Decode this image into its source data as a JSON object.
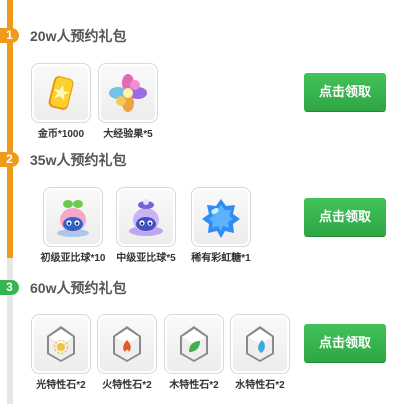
{
  "tiers": [
    {
      "number": "1",
      "title": "20w人预约礼包",
      "items": [
        {
          "label": "金币*1000",
          "icon": "gold-coin-icon"
        },
        {
          "label": "大经验果*5",
          "icon": "exp-fruit-icon"
        }
      ],
      "button": "点击领取"
    },
    {
      "number": "2",
      "title": "35w人预约礼包",
      "items": [
        {
          "label": "初级亚比球*10",
          "icon": "basic-pet-ball-icon"
        },
        {
          "label": "中级亚比球*5",
          "icon": "mid-pet-ball-icon"
        },
        {
          "label": "稀有彩虹糖*1",
          "icon": "rainbow-candy-icon"
        }
      ],
      "button": "点击领取"
    },
    {
      "number": "3",
      "title": "60w人预约礼包",
      "items": [
        {
          "label": "光特性石*2",
          "icon": "light-trait-stone-icon"
        },
        {
          "label": "火特性石*2",
          "icon": "fire-trait-stone-icon"
        },
        {
          "label": "木特性石*2",
          "icon": "wood-trait-stone-icon"
        },
        {
          "label": "水特性石*2",
          "icon": "water-trait-stone-icon"
        }
      ],
      "button": "点击领取"
    }
  ],
  "colors": {
    "timeline_active": "#f09a1c",
    "timeline_inactive": "#e6e6e6",
    "badge_current": "#34b64c",
    "button": "#3bb853"
  }
}
